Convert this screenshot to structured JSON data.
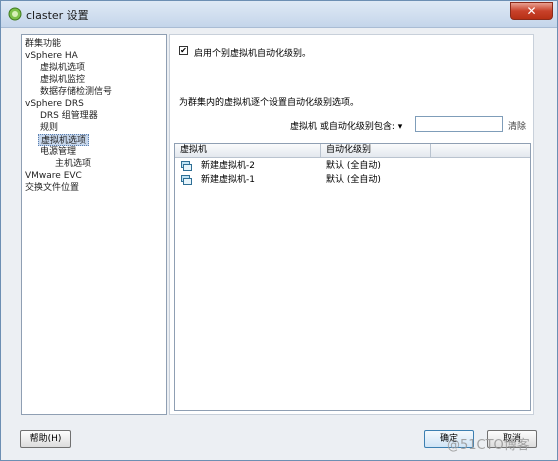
{
  "window": {
    "title": "claster 设置",
    "close_label": "✕"
  },
  "tree": {
    "items": [
      {
        "label": "群集功能"
      },
      {
        "label": "vSphere HA"
      },
      {
        "label": "虚拟机选项"
      },
      {
        "label": "虚拟机监控"
      },
      {
        "label": "数据存储检测信号"
      },
      {
        "label": "vSphere DRS"
      },
      {
        "label": "DRS 组管理器"
      },
      {
        "label": "规则"
      },
      {
        "label": "虚拟机选项"
      },
      {
        "label": "电源管理"
      },
      {
        "label": "主机选项"
      },
      {
        "label": "VMware EVC"
      },
      {
        "label": "交换文件位置"
      }
    ]
  },
  "main": {
    "enable_checkbox": {
      "label": "启用个别虚拟机自动化级别。",
      "checked": true
    },
    "instruction": "为群集内的虚拟机逐个设置自动化级别选项。",
    "filter": {
      "label": "虚拟机 或自动化级别包含: ▾",
      "value": "",
      "clear_label": "清除"
    },
    "table": {
      "columns": [
        "虚拟机",
        "自动化级别"
      ],
      "rows": [
        {
          "vm": "新建虚拟机-2",
          "level": "默认 (全自动)"
        },
        {
          "vm": "新建虚拟机-1",
          "level": "默认 (全自动)"
        }
      ]
    }
  },
  "footer": {
    "help_label": "帮助(H)",
    "ok_label": "确定",
    "cancel_label": "取消"
  },
  "watermark": "@51CTO博客"
}
